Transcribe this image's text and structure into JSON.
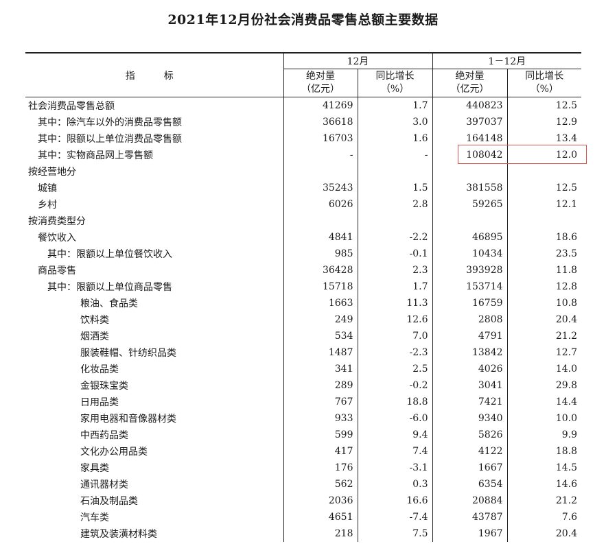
{
  "title": "2021年12月份社会消费品零售总额主要数据",
  "header": {
    "indicator": "指　标",
    "period_month": "12月",
    "period_ytd": "1－12月",
    "absolute_label": "绝对量",
    "absolute_unit": "（亿元）",
    "growth_label": "同比增长",
    "growth_unit": "（%）"
  },
  "rows": [
    {
      "name": "社会消费品零售总额",
      "m_abs": "41269",
      "m_yoy": "1.7",
      "y_abs": "440823",
      "y_yoy": "12.5"
    },
    {
      "name": "其中：除汽车以外的消费品零售额",
      "m_abs": "36618",
      "m_yoy": "3.0",
      "y_abs": "397037",
      "y_yoy": "12.9"
    },
    {
      "name": "其中：限额以上单位消费品零售额",
      "m_abs": "16703",
      "m_yoy": "1.6",
      "y_abs": "164148",
      "y_yoy": "13.4"
    },
    {
      "name": "其中：实物商品网上零售额",
      "m_abs": "-",
      "m_yoy": "-",
      "y_abs": "108042",
      "y_yoy": "12.0"
    },
    {
      "name": "按经营地分",
      "m_abs": "",
      "m_yoy": "",
      "y_abs": "",
      "y_yoy": ""
    },
    {
      "name": "城镇",
      "m_abs": "35243",
      "m_yoy": "1.5",
      "y_abs": "381558",
      "y_yoy": "12.5"
    },
    {
      "name": "乡村",
      "m_abs": "6026",
      "m_yoy": "2.8",
      "y_abs": "59265",
      "y_yoy": "12.1"
    },
    {
      "name": "按消费类型分",
      "m_abs": "",
      "m_yoy": "",
      "y_abs": "",
      "y_yoy": ""
    },
    {
      "name": "餐饮收入",
      "m_abs": "4841",
      "m_yoy": "-2.2",
      "y_abs": "46895",
      "y_yoy": "18.6"
    },
    {
      "name": "其中：限额以上单位餐饮收入",
      "m_abs": "985",
      "m_yoy": "-0.1",
      "y_abs": "10434",
      "y_yoy": "23.5"
    },
    {
      "name": "商品零售",
      "m_abs": "36428",
      "m_yoy": "2.3",
      "y_abs": "393928",
      "y_yoy": "11.8"
    },
    {
      "name": "其中：限额以上单位商品零售",
      "m_abs": "15718",
      "m_yoy": "1.7",
      "y_abs": "153714",
      "y_yoy": "12.8"
    },
    {
      "name": "粮油、食品类",
      "m_abs": "1663",
      "m_yoy": "11.3",
      "y_abs": "16759",
      "y_yoy": "10.8"
    },
    {
      "name": "饮料类",
      "m_abs": "249",
      "m_yoy": "12.6",
      "y_abs": "2808",
      "y_yoy": "20.4"
    },
    {
      "name": "烟酒类",
      "m_abs": "534",
      "m_yoy": "7.0",
      "y_abs": "4791",
      "y_yoy": "21.2"
    },
    {
      "name": "服装鞋帽、针纺织品类",
      "m_abs": "1487",
      "m_yoy": "-2.3",
      "y_abs": "13842",
      "y_yoy": "12.7"
    },
    {
      "name": "化妆品类",
      "m_abs": "341",
      "m_yoy": "2.5",
      "y_abs": "4026",
      "y_yoy": "14.0"
    },
    {
      "name": "金银珠宝类",
      "m_abs": "289",
      "m_yoy": "-0.2",
      "y_abs": "3041",
      "y_yoy": "29.8"
    },
    {
      "name": "日用品类",
      "m_abs": "767",
      "m_yoy": "18.8",
      "y_abs": "7421",
      "y_yoy": "14.4"
    },
    {
      "name": "家用电器和音像器材类",
      "m_abs": "933",
      "m_yoy": "-6.0",
      "y_abs": "9340",
      "y_yoy": "10.0"
    },
    {
      "name": "中西药品类",
      "m_abs": "599",
      "m_yoy": "9.4",
      "y_abs": "5826",
      "y_yoy": "9.9"
    },
    {
      "name": "文化办公用品类",
      "m_abs": "417",
      "m_yoy": "7.4",
      "y_abs": "4122",
      "y_yoy": "18.8"
    },
    {
      "name": "家具类",
      "m_abs": "176",
      "m_yoy": "-3.1",
      "y_abs": "1667",
      "y_yoy": "14.5"
    },
    {
      "name": "通讯器材类",
      "m_abs": "562",
      "m_yoy": "0.3",
      "y_abs": "6354",
      "y_yoy": "14.6"
    },
    {
      "name": "石油及制品类",
      "m_abs": "2036",
      "m_yoy": "16.6",
      "y_abs": "20884",
      "y_yoy": "21.2"
    },
    {
      "name": "汽车类",
      "m_abs": "4651",
      "m_yoy": "-7.4",
      "y_abs": "43787",
      "y_yoy": "7.6"
    },
    {
      "name": "建筑及装潢材料类",
      "m_abs": "218",
      "m_yoy": "7.5",
      "y_abs": "1967",
      "y_yoy": "20.4"
    }
  ],
  "highlight_color": "#e0524c"
}
